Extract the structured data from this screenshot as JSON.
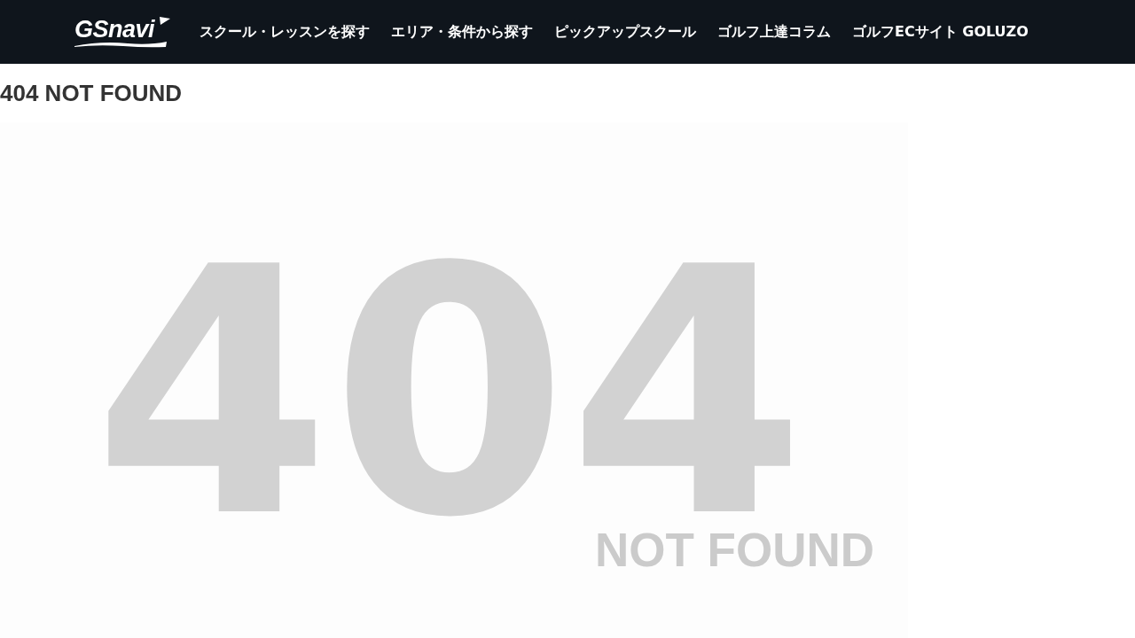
{
  "header": {
    "logo": "GSnavi",
    "nav": [
      "スクール・レッスンを探す",
      "エリア・条件から探す",
      "ピックアップスクール",
      "ゴルフ上達コラム",
      "ゴルフECサイト GOLUZO"
    ]
  },
  "page_title": "404 NOT FOUND",
  "error_image": {
    "code": "404",
    "message": "NOT FOUND"
  }
}
